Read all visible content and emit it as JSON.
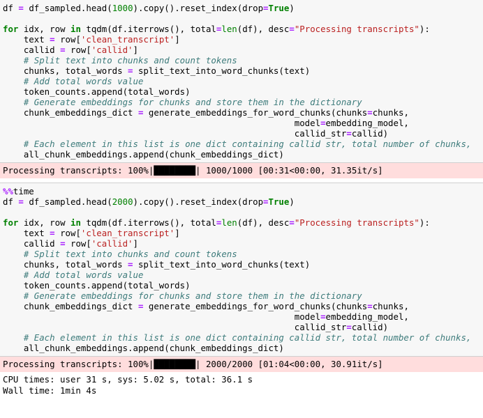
{
  "theme": {
    "code_cell_bg": "#f7f7f7",
    "stderr_bg": "#ffdddd",
    "stdout_bg": "#ffffff",
    "page_bg": "#ffffff",
    "border": "#cfcfcf",
    "keyword_color": "#008000",
    "operator_color": "#aa22ff",
    "string_color": "#ba2121",
    "comment_color": "#3d7b7b",
    "number_color": "#008000",
    "text_color": "#000000"
  },
  "cells": [
    {
      "type": "code",
      "name": "code-cell-1",
      "lines": [
        [
          {
            "t": "df ",
            "c": "plain"
          },
          {
            "t": "=",
            "c": "op"
          },
          {
            "t": " df_sampled.head(",
            "c": "plain"
          },
          {
            "t": "1000",
            "c": "num"
          },
          {
            "t": ").copy().reset_index(drop",
            "c": "plain"
          },
          {
            "t": "=",
            "c": "op"
          },
          {
            "t": "True",
            "c": "kw"
          },
          {
            "t": ")",
            "c": "plain"
          }
        ],
        [],
        [
          {
            "t": "for",
            "c": "kw"
          },
          {
            "t": " idx, row ",
            "c": "plain"
          },
          {
            "t": "in",
            "c": "kw"
          },
          {
            "t": " tqdm(df.iterrows(), total",
            "c": "plain"
          },
          {
            "t": "=",
            "c": "op"
          },
          {
            "t": "len",
            "c": "builtin"
          },
          {
            "t": "(df), desc",
            "c": "plain"
          },
          {
            "t": "=",
            "c": "op"
          },
          {
            "t": "\"Processing transcripts\"",
            "c": "str"
          },
          {
            "t": "):",
            "c": "plain"
          }
        ],
        [
          {
            "t": "    text ",
            "c": "plain"
          },
          {
            "t": "=",
            "c": "op"
          },
          {
            "t": " row[",
            "c": "plain"
          },
          {
            "t": "'clean_transcript'",
            "c": "str"
          },
          {
            "t": "]",
            "c": "plain"
          }
        ],
        [
          {
            "t": "    callid ",
            "c": "plain"
          },
          {
            "t": "=",
            "c": "op"
          },
          {
            "t": " row[",
            "c": "plain"
          },
          {
            "t": "'callid'",
            "c": "str"
          },
          {
            "t": "]",
            "c": "plain"
          }
        ],
        [
          {
            "t": "    ",
            "c": "plain"
          },
          {
            "t": "# Split text into chunks and count tokens",
            "c": "com"
          }
        ],
        [
          {
            "t": "    chunks, total_words ",
            "c": "plain"
          },
          {
            "t": "=",
            "c": "op"
          },
          {
            "t": " split_text_into_word_chunks(text)",
            "c": "plain"
          }
        ],
        [
          {
            "t": "    ",
            "c": "plain"
          },
          {
            "t": "# Add total words value",
            "c": "com"
          }
        ],
        [
          {
            "t": "    token_counts.append(total_words)",
            "c": "plain"
          }
        ],
        [
          {
            "t": "    ",
            "c": "plain"
          },
          {
            "t": "# Generate embeddings for chunks and store them in the dictionary",
            "c": "com"
          }
        ],
        [
          {
            "t": "    chunk_embeddings_dict ",
            "c": "plain"
          },
          {
            "t": "=",
            "c": "op"
          },
          {
            "t": " generate_embeddings_for_word_chunks(chunks",
            "c": "plain"
          },
          {
            "t": "=",
            "c": "op"
          },
          {
            "t": "chunks,",
            "c": "plain"
          }
        ],
        [
          {
            "t": "                                                        model",
            "c": "plain"
          },
          {
            "t": "=",
            "c": "op"
          },
          {
            "t": "embedding_model,",
            "c": "plain"
          }
        ],
        [
          {
            "t": "                                                        callid_str",
            "c": "plain"
          },
          {
            "t": "=",
            "c": "op"
          },
          {
            "t": "callid)",
            "c": "plain"
          }
        ],
        [
          {
            "t": "    ",
            "c": "plain"
          },
          {
            "t": "# Each element in this list is one dict containing callid str, total number of chunks,",
            "c": "com"
          }
        ],
        [
          {
            "t": "    all_chunk_embeddings.append(chunk_embeddings_dict)",
            "c": "plain"
          }
        ]
      ]
    },
    {
      "type": "stderr",
      "name": "output-progress-1",
      "progress": {
        "desc": "Processing transcripts:",
        "percent": "100%",
        "bar_left": "|",
        "bar_fill": "████████",
        "bar_right": "|",
        "counts": "1000/1000",
        "timing": "[00:31<00:00, 31.35it/s]"
      }
    },
    {
      "type": "code",
      "name": "code-cell-2",
      "lines": [
        [
          {
            "t": "%%",
            "c": "magic"
          },
          {
            "t": "time",
            "c": "plain"
          }
        ],
        [
          {
            "t": "df ",
            "c": "plain"
          },
          {
            "t": "=",
            "c": "op"
          },
          {
            "t": " df_sampled.head(",
            "c": "plain"
          },
          {
            "t": "2000",
            "c": "num"
          },
          {
            "t": ").copy().reset_index(drop",
            "c": "plain"
          },
          {
            "t": "=",
            "c": "op"
          },
          {
            "t": "True",
            "c": "kw"
          },
          {
            "t": ")",
            "c": "plain"
          }
        ],
        [],
        [
          {
            "t": "for",
            "c": "kw"
          },
          {
            "t": " idx, row ",
            "c": "plain"
          },
          {
            "t": "in",
            "c": "kw"
          },
          {
            "t": " tqdm(df.iterrows(), total",
            "c": "plain"
          },
          {
            "t": "=",
            "c": "op"
          },
          {
            "t": "len",
            "c": "builtin"
          },
          {
            "t": "(df), desc",
            "c": "plain"
          },
          {
            "t": "=",
            "c": "op"
          },
          {
            "t": "\"Processing transcripts\"",
            "c": "str"
          },
          {
            "t": "):",
            "c": "plain"
          }
        ],
        [
          {
            "t": "    text ",
            "c": "plain"
          },
          {
            "t": "=",
            "c": "op"
          },
          {
            "t": " row[",
            "c": "plain"
          },
          {
            "t": "'clean_transcript'",
            "c": "str"
          },
          {
            "t": "]",
            "c": "plain"
          }
        ],
        [
          {
            "t": "    callid ",
            "c": "plain"
          },
          {
            "t": "=",
            "c": "op"
          },
          {
            "t": " row[",
            "c": "plain"
          },
          {
            "t": "'callid'",
            "c": "str"
          },
          {
            "t": "]",
            "c": "plain"
          }
        ],
        [
          {
            "t": "    ",
            "c": "plain"
          },
          {
            "t": "# Split text into chunks and count tokens",
            "c": "com"
          }
        ],
        [
          {
            "t": "    chunks, total_words ",
            "c": "plain"
          },
          {
            "t": "=",
            "c": "op"
          },
          {
            "t": " split_text_into_word_chunks(text)",
            "c": "plain"
          }
        ],
        [
          {
            "t": "    ",
            "c": "plain"
          },
          {
            "t": "# Add total words value",
            "c": "com"
          }
        ],
        [
          {
            "t": "    token_counts.append(total_words)",
            "c": "plain"
          }
        ],
        [
          {
            "t": "    ",
            "c": "plain"
          },
          {
            "t": "# Generate embeddings for chunks and store them in the dictionary",
            "c": "com"
          }
        ],
        [
          {
            "t": "    chunk_embeddings_dict ",
            "c": "plain"
          },
          {
            "t": "=",
            "c": "op"
          },
          {
            "t": " generate_embeddings_for_word_chunks(chunks",
            "c": "plain"
          },
          {
            "t": "=",
            "c": "op"
          },
          {
            "t": "chunks,",
            "c": "plain"
          }
        ],
        [
          {
            "t": "                                                        model",
            "c": "plain"
          },
          {
            "t": "=",
            "c": "op"
          },
          {
            "t": "embedding_model,",
            "c": "plain"
          }
        ],
        [
          {
            "t": "                                                        callid_str",
            "c": "plain"
          },
          {
            "t": "=",
            "c": "op"
          },
          {
            "t": "callid)",
            "c": "plain"
          }
        ],
        [
          {
            "t": "    ",
            "c": "plain"
          },
          {
            "t": "# Each element in this list is one dict containing callid str, total number of chunks,",
            "c": "com"
          }
        ],
        [
          {
            "t": "    all_chunk_embeddings.append(chunk_embeddings_dict)",
            "c": "plain"
          }
        ]
      ]
    },
    {
      "type": "stderr",
      "name": "output-progress-2",
      "progress": {
        "desc": "Processing transcripts:",
        "percent": "100%",
        "bar_left": "|",
        "bar_fill": "████████",
        "bar_right": "|",
        "counts": "2000/2000",
        "timing": "[01:04<00:00, 30.91it/s]"
      }
    },
    {
      "type": "stdout",
      "name": "output-timing",
      "lines": [
        "CPU times: user 31 s, sys: 5.02 s, total: 36.1 s",
        "Wall time: 1min 4s"
      ]
    }
  ]
}
